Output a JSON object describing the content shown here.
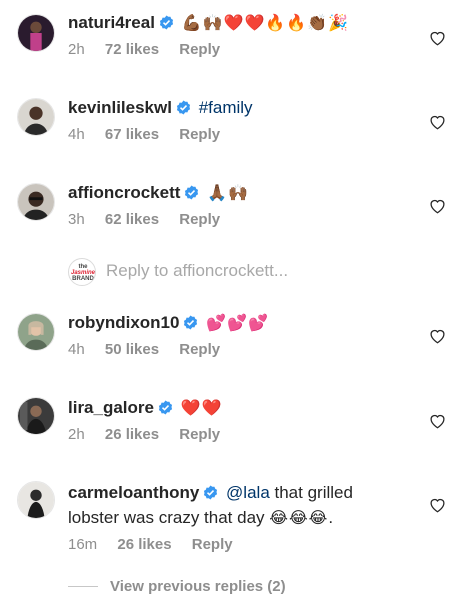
{
  "comments": [
    {
      "username": "naturi4real",
      "verified": true,
      "text": "",
      "emojis": "💪🏾🙌🏾❤️❤️🔥🔥👏🏾🎉",
      "time": "2h",
      "likes": "72 likes",
      "reply": "Reply"
    },
    {
      "username": "kevinlileskwl",
      "verified": true,
      "text": "#family",
      "emojis": "",
      "time": "4h",
      "likes": "67 likes",
      "reply": "Reply"
    },
    {
      "username": "affioncrockett",
      "verified": true,
      "text": "",
      "emojis": "🙏🏾🙌🏾",
      "time": "3h",
      "likes": "62 likes",
      "reply": "Reply"
    },
    {
      "username": "robyndixon10",
      "verified": true,
      "text": "",
      "emojis": "💕💕💕",
      "time": "4h",
      "likes": "50 likes",
      "reply": "Reply"
    },
    {
      "username": "lira_galore",
      "verified": true,
      "text": "",
      "emojis": "❤️❤️",
      "time": "2h",
      "likes": "26 likes",
      "reply": "Reply"
    },
    {
      "username": "carmeloanthony",
      "verified": true,
      "mention": "@lala",
      "text_rest": " that grilled",
      "line2_text": "lobster was crazy that day ",
      "line2_emojis": "😂😂😂",
      "line2_end": ".",
      "time": "16m",
      "likes": "26 likes",
      "reply": "Reply"
    }
  ],
  "reply_input": {
    "placeholder": "Reply to affioncrockett...",
    "avatar_brand": [
      "the",
      "Jasmine",
      "BRAND"
    ]
  },
  "view_previous": "View previous replies (2)",
  "colors": {
    "verified": "#3897f0",
    "username": "#262626",
    "meta": "#8e8e8e",
    "hashtag": "#003569"
  }
}
